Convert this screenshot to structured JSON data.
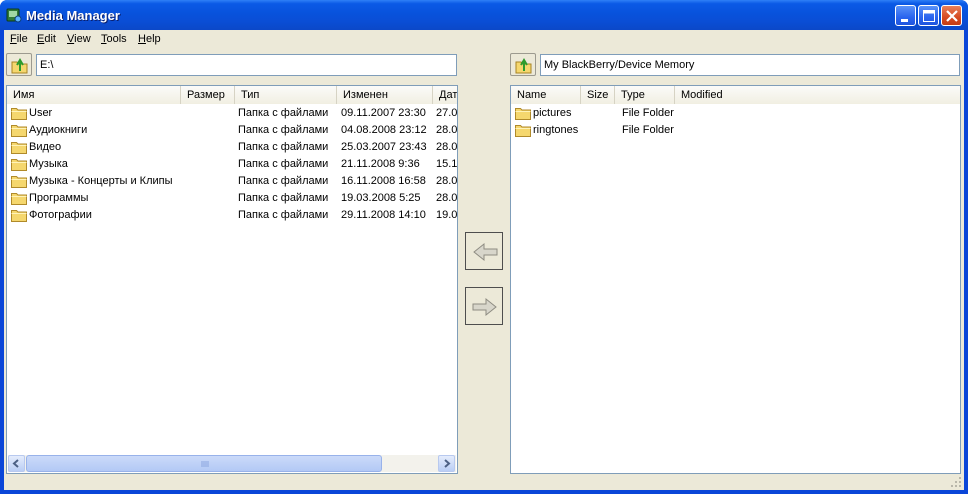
{
  "window": {
    "title": "Media Manager"
  },
  "menu": [
    {
      "label": "File",
      "mn": "F",
      "rest": "ile"
    },
    {
      "label": "Edit",
      "mn": "E",
      "rest": "dit"
    },
    {
      "label": "View",
      "mn": "V",
      "rest": "iew"
    },
    {
      "label": "Tools",
      "mn": "T",
      "rest": "ools"
    },
    {
      "label": "Help",
      "mn": "H",
      "rest": "elp"
    }
  ],
  "left_pane": {
    "path": "E:\\",
    "columns": [
      "Имя",
      "Размер",
      "Тип",
      "Изменен",
      "Дат"
    ],
    "rows": [
      {
        "name": "User",
        "size": "",
        "type": "Папка с файлами",
        "modified": "09.11.2007 23:30",
        "date": "27.0"
      },
      {
        "name": "Аудиокниги",
        "size": "",
        "type": "Папка с файлами",
        "modified": "04.08.2008 23:12",
        "date": "28.0"
      },
      {
        "name": "Видео",
        "size": "",
        "type": "Папка с файлами",
        "modified": "25.03.2007 23:43",
        "date": "28.0"
      },
      {
        "name": "Музыка",
        "size": "",
        "type": "Папка с файлами",
        "modified": "21.11.2008 9:36",
        "date": "15.1"
      },
      {
        "name": "Музыка - Концерты и Клипы",
        "size": "",
        "type": "Папка с файлами",
        "modified": "16.11.2008 16:58",
        "date": "28.0"
      },
      {
        "name": "Программы",
        "size": "",
        "type": "Папка с файлами",
        "modified": "19.03.2008 5:25",
        "date": "28.0"
      },
      {
        "name": "Фотографии",
        "size": "",
        "type": "Папка с файлами",
        "modified": "29.11.2008 14:10",
        "date": "19.0"
      }
    ]
  },
  "right_pane": {
    "path": "My BlackBerry/Device Memory",
    "columns": [
      "Name",
      "Size",
      "Type",
      "Modified"
    ],
    "rows": [
      {
        "name": "pictures",
        "size": "",
        "type": "File Folder",
        "modified": ""
      },
      {
        "name": "ringtones",
        "size": "",
        "type": "File Folder",
        "modified": ""
      }
    ]
  },
  "icons": {
    "app": "media-manager-icon",
    "up": "up-folder-icon",
    "folder": "folder-icon",
    "left_arrow": "arrow-left-icon",
    "right_arrow": "arrow-right-icon"
  },
  "colors": {
    "title_bar": "#0a4ed6",
    "frame": "#ece9d8",
    "close": "#d64b22",
    "folder": "#f5d76e"
  }
}
